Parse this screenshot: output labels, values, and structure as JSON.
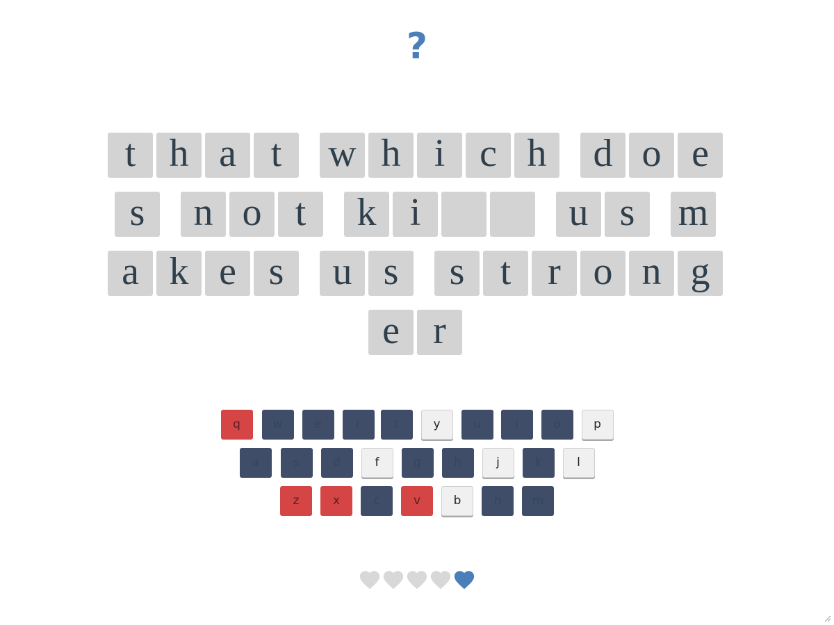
{
  "header": {
    "help_label": "?"
  },
  "puzzle": {
    "rows": [
      [
        [
          "t",
          "h",
          "a",
          "t"
        ],
        [
          "w",
          "h",
          "i",
          "c",
          "h"
        ],
        [
          "d",
          "o",
          "e"
        ]
      ],
      [
        [
          "s"
        ],
        [
          "n",
          "o",
          "t"
        ],
        [
          "k",
          "i",
          "",
          ""
        ],
        [
          "u",
          "s"
        ],
        [
          "m"
        ]
      ],
      [
        [
          "a",
          "k",
          "e",
          "s"
        ],
        [
          "u",
          "s"
        ],
        [
          "s",
          "t",
          "r",
          "o",
          "n",
          "g"
        ]
      ],
      [
        [
          "e",
          "r"
        ]
      ]
    ]
  },
  "keyboard": {
    "rows": [
      [
        {
          "k": "q",
          "state": "wrong"
        },
        {
          "k": "w",
          "state": "used"
        },
        {
          "k": "e",
          "state": "used"
        },
        {
          "k": "r",
          "state": "used"
        },
        {
          "k": "t",
          "state": "used"
        },
        {
          "k": "y",
          "state": "avail"
        },
        {
          "k": "u",
          "state": "used"
        },
        {
          "k": "i",
          "state": "used"
        },
        {
          "k": "o",
          "state": "used"
        },
        {
          "k": "p",
          "state": "avail"
        }
      ],
      [
        {
          "k": "a",
          "state": "used"
        },
        {
          "k": "s",
          "state": "used"
        },
        {
          "k": "d",
          "state": "used"
        },
        {
          "k": "f",
          "state": "avail"
        },
        {
          "k": "g",
          "state": "used"
        },
        {
          "k": "h",
          "state": "used"
        },
        {
          "k": "j",
          "state": "avail"
        },
        {
          "k": "k",
          "state": "used"
        },
        {
          "k": "l",
          "state": "avail"
        }
      ],
      [
        {
          "k": "z",
          "state": "wrong"
        },
        {
          "k": "x",
          "state": "wrong"
        },
        {
          "k": "c",
          "state": "used"
        },
        {
          "k": "v",
          "state": "wrong"
        },
        {
          "k": "b",
          "state": "avail"
        },
        {
          "k": "n",
          "state": "used"
        },
        {
          "k": "m",
          "state": "used"
        }
      ]
    ]
  },
  "lives": {
    "total": 5,
    "remaining": 1,
    "lost_color": "#d8d8d8",
    "active_color": "#4a7fb9"
  },
  "colors": {
    "accent": "#4a7fb9",
    "wrong": "#d64545",
    "used": "#3f4d69",
    "tile": "#d3d3d3"
  }
}
